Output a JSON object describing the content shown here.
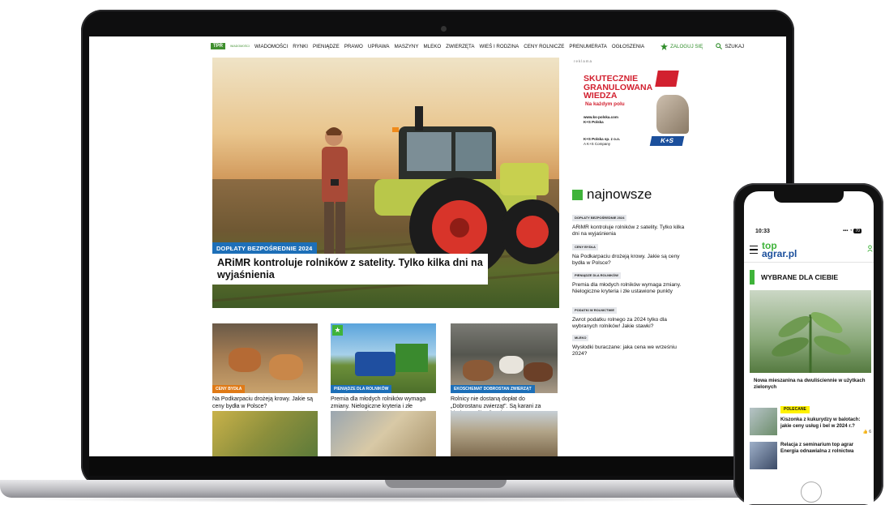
{
  "site": {
    "logo": "TPR",
    "logo_sub": "WIADOMOŚCI",
    "nav": [
      "WIADOMOŚCI",
      "RYNKI",
      "PIENIĄDZE",
      "PRAWO",
      "UPRAWA",
      "MASZYNY",
      "MLEKO",
      "ZWIERZĘTA",
      "WIEŚ I RODZINA",
      "CENY ROLNICZE",
      "PRENUMERATA",
      "OGŁOSZENIA"
    ],
    "login": "ZALOGUJ SIĘ",
    "search": "SZUKAJ"
  },
  "hero": {
    "tag": "DOPŁATY BEZPOŚREDNIE 2024",
    "title": "ARiMR kontroluje rolników z satelity. Tylko kilka dni na wyjaśnienia"
  },
  "ad": {
    "label": "reklama",
    "headline": [
      "SKUTECZNIE",
      "GRANULOWANA",
      "WIEDZA"
    ],
    "sub": "Na każdym polu",
    "url": "www.ks-polska.com",
    "social": "K+S Polska",
    "company": "K+S Polska sp. z o.o.",
    "company2": "A K+S Company",
    "brand": "K+S"
  },
  "latest": {
    "heading": "najnowsze",
    "items": [
      {
        "tag": "DOPŁATY BEZPOŚREDNIE 2024",
        "title": "ARiMR kontroluje rolników z satelity. Tylko kilka dni na wyjaśnienia"
      },
      {
        "tag": "CENY BYDŁA",
        "title": "Na Podkarpaciu drożeją krowy. Jakie są ceny bydła w Polsce?"
      },
      {
        "tag": "PIENIĄDZE DLA ROLNIKÓW",
        "title": "Premia dla młodych rolników wymaga zmiany. Nielogiczne kryteria i złe ustawione punkty"
      },
      {
        "tag": "PODATKI W ROLNICTWIE",
        "title": "Zwrot podatku rolnego za 2024 tylko dla wybranych rolników! Jakie stawki?"
      },
      {
        "tag": "MLEKO",
        "title": "Wysłodki buraczane: jaka cena we wrześniu 2024?"
      }
    ]
  },
  "cards": [
    {
      "tag": "CENY BYDŁA",
      "tag_color": "#e07a16",
      "title": "Na Podkarpaciu drożeją krowy. Jakie są ceny bydła w Polsce?"
    },
    {
      "tag": "PIENIĄDZE DLA ROLNIKÓW",
      "tag_color": "#1d6fb8",
      "title": "Premia dla młodych rolników wymaga zmiany. Nielogiczne kryteria i złe ustawione punkty"
    },
    {
      "tag": "EKOSCHEMAT DOBROSTAN ZWIERZĄT",
      "tag_color": "#1d6fb8",
      "title": "Rolnicy nie dostaną dopłat do „Dobrostanu zwierząt\". Są karani za błędy w aplikacji ARiMR"
    }
  ],
  "phone": {
    "time": "10:33",
    "status": "70",
    "logo_top": "top",
    "logo_bottom": "agrar.pl",
    "section": "WYBRANE DLA CIEBIE",
    "lead_caption": "Nowa mieszanina na dwuliściennie w użytkach zielonych",
    "rows": [
      {
        "tag": "POLECANE",
        "title": "Kiszonka z kukurydzy w balotach: jakie ceny usług i bel w 2024 r.?",
        "likes": "6"
      },
      {
        "tag": "",
        "title": "Relacja z seminarium top agrar Energia odnawialna z rolnictwa",
        "likes": ""
      }
    ]
  }
}
